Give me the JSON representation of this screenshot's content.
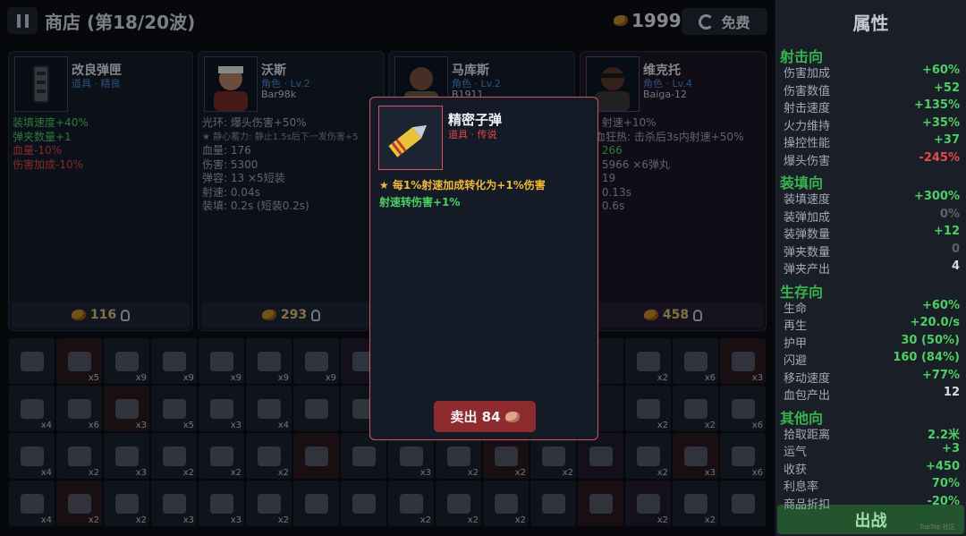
{
  "header": {
    "title": "商店 (第18/20波)",
    "gold": "1999",
    "refresh_label": "免费"
  },
  "cards": [
    {
      "name": "改良弹匣",
      "tag": "道具 · 精良",
      "weapon": "",
      "lines": [
        {
          "t": "装填速度+40%",
          "c": "g"
        },
        {
          "t": "弹夹数量+1",
          "c": "g"
        },
        {
          "t": "血量-10%",
          "c": "r"
        },
        {
          "t": "伤害加成-10%",
          "c": "r"
        }
      ],
      "price": "116"
    },
    {
      "name": "沃斯",
      "tag": "角色 · Lv.2",
      "weapon": "Bar98k",
      "lines": [
        {
          "t": "光环: 爆头伤害+50%",
          "c": ""
        },
        {
          "t": "★ 静心蓄力: 静止1.5s后下一发伤害+5",
          "c": "tiny"
        },
        {
          "t": "血量: 176",
          "c": ""
        },
        {
          "t": "伤害: 5300",
          "c": ""
        },
        {
          "t": "弹容: 13 ×5短装",
          "c": ""
        },
        {
          "t": "射速: 0.04s",
          "c": ""
        },
        {
          "t": "装填: 0.2s (短装0.2s)",
          "c": ""
        }
      ],
      "price": "293"
    },
    {
      "name": "马库斯",
      "tag": "角色 · Lv.2",
      "weapon": "B1911",
      "lines": [],
      "price": ""
    },
    {
      "name": "维克托",
      "tag": "角色 · Lv.4",
      "weapon": "Baiga-12",
      "lines": [
        {
          "t": "环: 射速+10%",
          "c": ""
        },
        {
          "t": "嗜血狂热: 击杀后3s内射速+50%",
          "c": ""
        },
        {
          "t": "量: 266",
          "c": ""
        },
        {
          "t": "害: 5966 ×6弹丸",
          "c": ""
        },
        {
          "t": "容: 19",
          "c": ""
        },
        {
          "t": "速: 0.13s",
          "c": ""
        },
        {
          "t": "填: 0.6s",
          "c": ""
        }
      ],
      "price": "458"
    }
  ],
  "inventory": [
    {
      "n": "can-icon",
      "c": "",
      "k": ""
    },
    {
      "n": "pink-creature-icon",
      "c": "x5",
      "k": "red"
    },
    {
      "n": "dark-hair-character-icon",
      "c": "x9",
      "k": ""
    },
    {
      "n": "green-beret-soldier-icon",
      "c": "x9",
      "k": ""
    },
    {
      "n": "helmet-soldier-icon",
      "c": "x9",
      "k": ""
    },
    {
      "n": "hooded-character-icon",
      "c": "x9",
      "k": ""
    },
    {
      "n": "ranger-hat-icon",
      "c": "x9",
      "k": ""
    },
    {
      "n": "id-card-icon",
      "c": "x9",
      "k": "pur"
    },
    {
      "n": "slot",
      "c": "",
      "k": ""
    },
    {
      "n": "slot",
      "c": "",
      "k": ""
    },
    {
      "n": "slot",
      "c": "",
      "k": ""
    },
    {
      "n": "slot",
      "c": "",
      "k": ""
    },
    {
      "n": "slot",
      "c": "",
      "k": ""
    },
    {
      "n": "backpack-icon",
      "c": "x2",
      "k": ""
    },
    {
      "n": "jacket-icon",
      "c": "x6",
      "k": ""
    },
    {
      "n": "pink-badge-icon",
      "c": "x3",
      "k": "red"
    },
    {
      "n": "coffee-cup-icon",
      "c": "x4",
      "k": ""
    },
    {
      "n": "bandage-icon",
      "c": "x6",
      "k": ""
    },
    {
      "n": "first-aid-kit-icon",
      "c": "x3",
      "k": "red"
    },
    {
      "n": "grenade-icon",
      "c": "x5",
      "k": ""
    },
    {
      "n": "pistol-icon",
      "c": "x3",
      "k": ""
    },
    {
      "n": "notebook-icon",
      "c": "x4",
      "k": ""
    },
    {
      "n": "vest-icon",
      "c": "",
      "k": ""
    },
    {
      "n": "scroll-icon",
      "c": "",
      "k": ""
    },
    {
      "n": "slot",
      "c": "",
      "k": ""
    },
    {
      "n": "slot",
      "c": "",
      "k": ""
    },
    {
      "n": "slot",
      "c": "",
      "k": ""
    },
    {
      "n": "slot",
      "c": "",
      "k": ""
    },
    {
      "n": "slot",
      "c": "",
      "k": ""
    },
    {
      "n": "boots-icon",
      "c": "x2",
      "k": ""
    },
    {
      "n": "helmet-icon",
      "c": "x2",
      "k": ""
    },
    {
      "n": "gloves-icon",
      "c": "x6",
      "k": ""
    },
    {
      "n": "bullet-icon",
      "c": "x4",
      "k": ""
    },
    {
      "n": "ammo-box-icon",
      "c": "x2",
      "k": ""
    },
    {
      "n": "magazine-icon",
      "c": "x3",
      "k": ""
    },
    {
      "n": "radio-icon",
      "c": "x2",
      "k": ""
    },
    {
      "n": "grip-icon",
      "c": "x2",
      "k": ""
    },
    {
      "n": "bag-icon",
      "c": "x2",
      "k": ""
    },
    {
      "n": "pink-armor-icon",
      "c": "",
      "k": "red"
    },
    {
      "n": "syringe-icon",
      "c": "",
      "k": ""
    },
    {
      "n": "shell-icon",
      "c": "x3",
      "k": ""
    },
    {
      "n": "hand-icon",
      "c": "x2",
      "k": ""
    },
    {
      "n": "red-device-icon",
      "c": "x2",
      "k": "red"
    },
    {
      "n": "belt-icon",
      "c": "x2",
      "k": ""
    },
    {
      "n": "purple-gun-icon",
      "c": "",
      "k": "pur"
    },
    {
      "n": "knife-icon",
      "c": "x2",
      "k": ""
    },
    {
      "n": "rocket-icon",
      "c": "x3",
      "k": "red"
    },
    {
      "n": "bucket-icon",
      "c": "x6",
      "k": ""
    },
    {
      "n": "camo-boots-icon",
      "c": "x4",
      "k": ""
    },
    {
      "n": "piggy-bank-icon",
      "c": "x2",
      "k": "red"
    },
    {
      "n": "helmet-pot-icon",
      "c": "x2",
      "k": ""
    },
    {
      "n": "mag-pouch-icon",
      "c": "x3",
      "k": ""
    },
    {
      "n": "ammo-can-icon",
      "c": "x3",
      "k": ""
    },
    {
      "n": "binoculars-icon",
      "c": "x2",
      "k": ""
    },
    {
      "n": "long-mag-icon",
      "c": "",
      "k": ""
    },
    {
      "n": "steel-helmet-icon",
      "c": "",
      "k": ""
    },
    {
      "n": "ammo-clip-icon",
      "c": "x2",
      "k": ""
    },
    {
      "n": "pack-icon",
      "c": "x2",
      "k": ""
    },
    {
      "n": "flashlight-icon",
      "c": "x2",
      "k": ""
    },
    {
      "n": "compass-icon",
      "c": "",
      "k": ""
    },
    {
      "n": "gold-bullet-icon",
      "c": "",
      "k": "red"
    },
    {
      "n": "grape-grenade-icon",
      "c": "x2",
      "k": "pur"
    },
    {
      "n": "crate-icon",
      "c": "x2",
      "k": ""
    },
    {
      "n": "gold-syringe-icon",
      "c": "",
      "k": ""
    }
  ],
  "stats": {
    "title": "属性",
    "sections": [
      {
        "name": "射击向",
        "rows": [
          {
            "l": "伤害加成",
            "v": "+60%",
            "c": "g"
          },
          {
            "l": "伤害数值",
            "v": "+52",
            "c": "g"
          },
          {
            "l": "射击速度",
            "v": "+135%",
            "c": "g"
          },
          {
            "l": "火力维持",
            "v": "+35%",
            "c": "g"
          },
          {
            "l": "操控性能",
            "v": "+37",
            "c": "g"
          },
          {
            "l": "爆头伤害",
            "v": "-245%",
            "c": "r"
          }
        ]
      },
      {
        "name": "装填向",
        "rows": [
          {
            "l": "装填速度",
            "v": "+300%",
            "c": "g"
          },
          {
            "l": "装弹加成",
            "v": "0%",
            "c": "z"
          },
          {
            "l": "装弹数量",
            "v": "+12",
            "c": "g"
          },
          {
            "l": "弹夹数量",
            "v": "0",
            "c": "z"
          },
          {
            "l": "弹夹产出",
            "v": "4",
            "c": "w"
          }
        ]
      },
      {
        "name": "生存向",
        "rows": [
          {
            "l": "生命",
            "v": "+60%",
            "c": "g"
          },
          {
            "l": "再生",
            "v": "+20.0/s",
            "c": "g"
          },
          {
            "l": "护甲",
            "v": "30 (50%)",
            "c": "g"
          },
          {
            "l": "闪避",
            "v": "160 (84%)",
            "c": "g"
          },
          {
            "l": "移动速度",
            "v": "+77%",
            "c": "g"
          },
          {
            "l": "血包产出",
            "v": "12",
            "c": "w"
          }
        ]
      },
      {
        "name": "其他向",
        "rows": [
          {
            "l": "拾取距离",
            "v": "2.2米",
            "c": "g"
          },
          {
            "l": "运气",
            "v": "+3",
            "c": "g"
          },
          {
            "l": "收获",
            "v": "+450",
            "c": "g"
          },
          {
            "l": "利息率",
            "v": "70%",
            "c": "g"
          },
          {
            "l": "商品折扣",
            "v": "-20%",
            "c": "g"
          }
        ]
      }
    ],
    "fight_label": "出战",
    "watermark": "TapTap 社区"
  },
  "popup": {
    "name": "精密子弹",
    "tag": "道具 · 传说",
    "desc1": "★ 每1%射速加成转化为+1%伤害",
    "desc2": "射速转伤害+1%",
    "sell_label": "卖出 84"
  }
}
